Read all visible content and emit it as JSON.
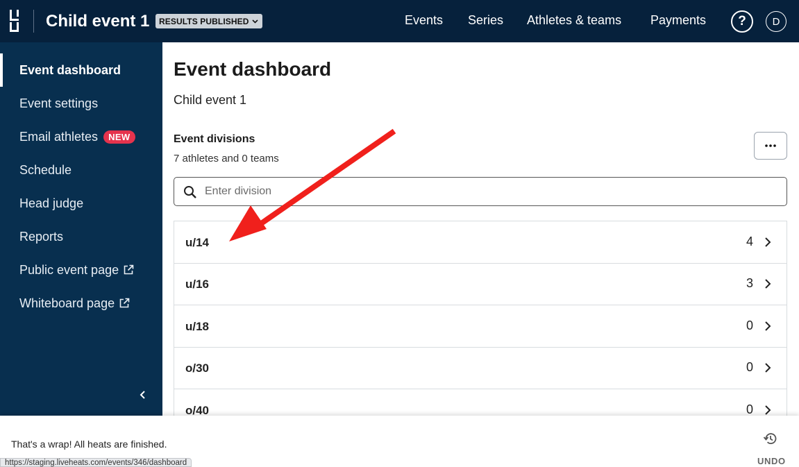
{
  "header": {
    "event_title": "Child event 1",
    "status_badge": "RESULTS PUBLISHED",
    "nav": [
      "Events",
      "Series",
      "Athletes & teams",
      "Payments"
    ],
    "help_label": "?",
    "avatar_initial": "D"
  },
  "sidebar": {
    "items": [
      {
        "label": "Event dashboard"
      },
      {
        "label": "Event settings"
      },
      {
        "label": "Email athletes",
        "badge": "NEW"
      },
      {
        "label": "Schedule"
      },
      {
        "label": "Head judge"
      },
      {
        "label": "Reports"
      },
      {
        "label": "Public event page"
      },
      {
        "label": "Whiteboard page"
      }
    ]
  },
  "main": {
    "title": "Event dashboard",
    "subtitle": "Child event 1",
    "divisions_heading": "Event divisions",
    "divisions_summary": "7 athletes and 0 teams",
    "search_placeholder": "Enter division",
    "divisions": [
      {
        "name": "u/14",
        "count": "4"
      },
      {
        "name": "u/16",
        "count": "3"
      },
      {
        "name": "u/18",
        "count": "0"
      },
      {
        "name": "o/30",
        "count": "0"
      },
      {
        "name": "o/40",
        "count": "0"
      }
    ]
  },
  "toast": {
    "message": "That's a wrap! All heats are finished.",
    "undo_label": "UNDO"
  },
  "status_url": "https://staging.liveheats.com/events/346/dashboard",
  "colors": {
    "topbar": "#06213c",
    "sidebar": "#082f4f",
    "new_badge": "#e5334d",
    "annotation_arrow": "#f0201c"
  },
  "icons": [
    "logo-icon",
    "chevron-down-icon",
    "help-icon",
    "external-link-icon",
    "chevron-left-icon",
    "search-icon",
    "more-icon",
    "chevron-right-icon",
    "history-icon",
    "annotation-arrow"
  ]
}
